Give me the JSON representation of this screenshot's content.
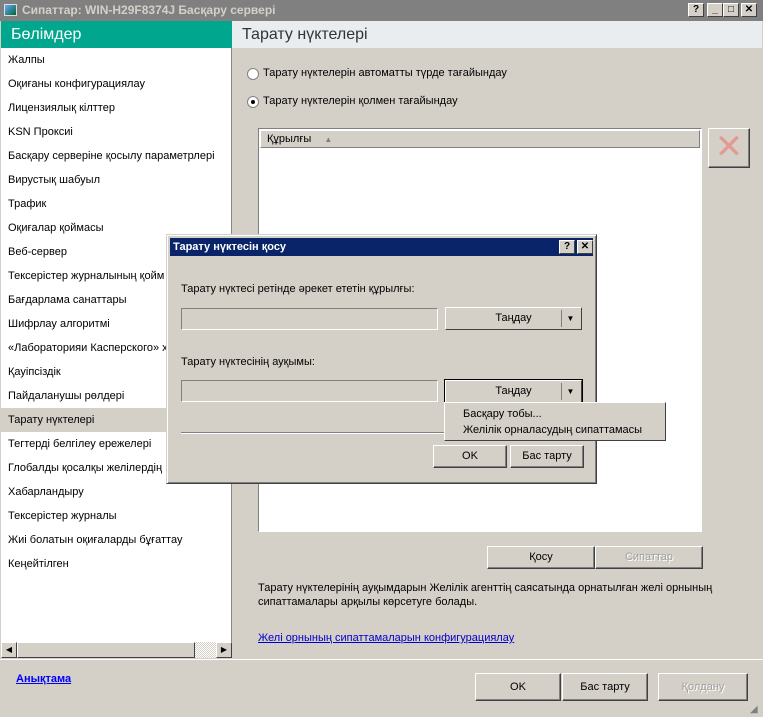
{
  "window": {
    "title": "Сипаттар: WIN-H29F8374J Басқару сервері",
    "help": "?",
    "minimize": "_",
    "maximize": "□",
    "close": "✕"
  },
  "sidebar": {
    "header": "Бөлімдер",
    "items": [
      {
        "label": "Жалпы"
      },
      {
        "label": "Оқиғаны конфигурациялау"
      },
      {
        "label": "Лицензиялық кілттер"
      },
      {
        "label": "KSN Проксиі"
      },
      {
        "label": "Басқару серверіне қосылу параметрлері"
      },
      {
        "label": "Вирустық шабуыл"
      },
      {
        "label": "Трафик"
      },
      {
        "label": "Оқиғалар қоймасы"
      },
      {
        "label": "Веб-сервер"
      },
      {
        "label": "Тексерістер журналының қойм"
      },
      {
        "label": "Бағдарлама санаттары"
      },
      {
        "label": "Шифрлау алгоритмі"
      },
      {
        "label": "«Лабораторияи Касперского» х"
      },
      {
        "label": "Қауіпсіздік"
      },
      {
        "label": "Пайдаланушы рөлдері"
      },
      {
        "label": "Тарату нүктелері",
        "selected": true
      },
      {
        "label": "Тегтерді белгілеу ережелері"
      },
      {
        "label": "Глобалды қосалқы желілердің"
      },
      {
        "label": "Хабарландыру"
      },
      {
        "label": "Тексерістер журналы"
      },
      {
        "label": "Жиі болатын оқиғаларды бұғаттау"
      },
      {
        "label": "Кеңейтілген"
      }
    ]
  },
  "page": {
    "title": "Тарату нүктелері",
    "radio_auto": "Тарату нүктелерін автоматты түрде тағайындау",
    "radio_manual": "Тарату нүктелерін қолмен тағайындау",
    "list_column": "Құрылғы",
    "add": "Қосу",
    "properties": "Сипаттар",
    "info": "Тарату нүктелерінің ауқымдарын Желілік агенттің саясатында орнатылған желі орнының сипаттамалары арқылы көрсетуге болады.",
    "link": "Желі орнының сипаттамаларын конфигурациялау"
  },
  "footer": {
    "help_link": "Анықтама",
    "ok": "OK",
    "cancel": "Бас тарту",
    "apply": "Қолдану"
  },
  "dialog": {
    "title": "Тарату нүктесін қосу",
    "help": "?",
    "close": "✕",
    "device_label": "Тарату нүктесі ретінде әрекет ететін құрылғы:",
    "device_value": "",
    "device_button": "Таңдау",
    "scope_label": "Тарату нүктесінің ауқымы:",
    "scope_value": "",
    "scope_button": "Таңдау",
    "ok": "OK",
    "cancel": "Бас тарту",
    "menu": [
      "Басқару тобы...",
      "Желілік орналасудың сипаттамасы"
    ]
  }
}
